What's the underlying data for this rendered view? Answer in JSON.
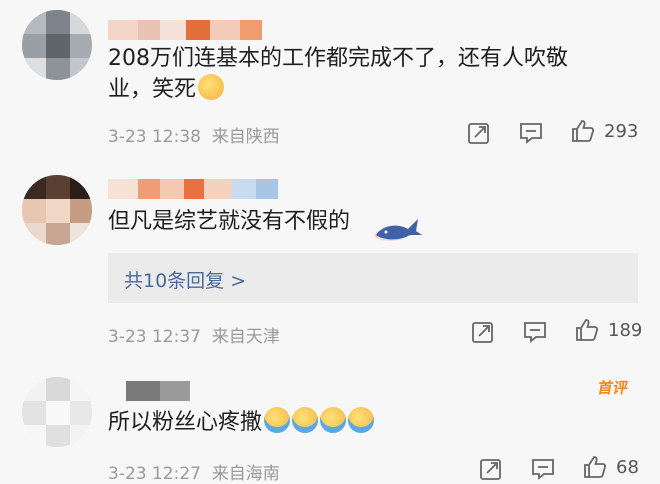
{
  "comments": [
    {
      "text_line1": "208万们连基本的工作都完成不了，还有人吹敬",
      "text_line2": "业，笑死",
      "time": "3-23 12:38",
      "location": "来自陕西",
      "likes": "293"
    },
    {
      "text": "但凡是综艺就没有不假的",
      "replies_label": "共10条回复 >",
      "time": "3-23 12:37",
      "location": "来自天津",
      "likes": "189"
    },
    {
      "text": "所以粉丝心疼撒",
      "badge": "首评",
      "time": "3-23 12:27",
      "location": "来自海南",
      "likes": "68"
    }
  ],
  "icons": {
    "share": "share-icon",
    "reply": "comment-icon",
    "like": "thumbs-up-icon"
  }
}
